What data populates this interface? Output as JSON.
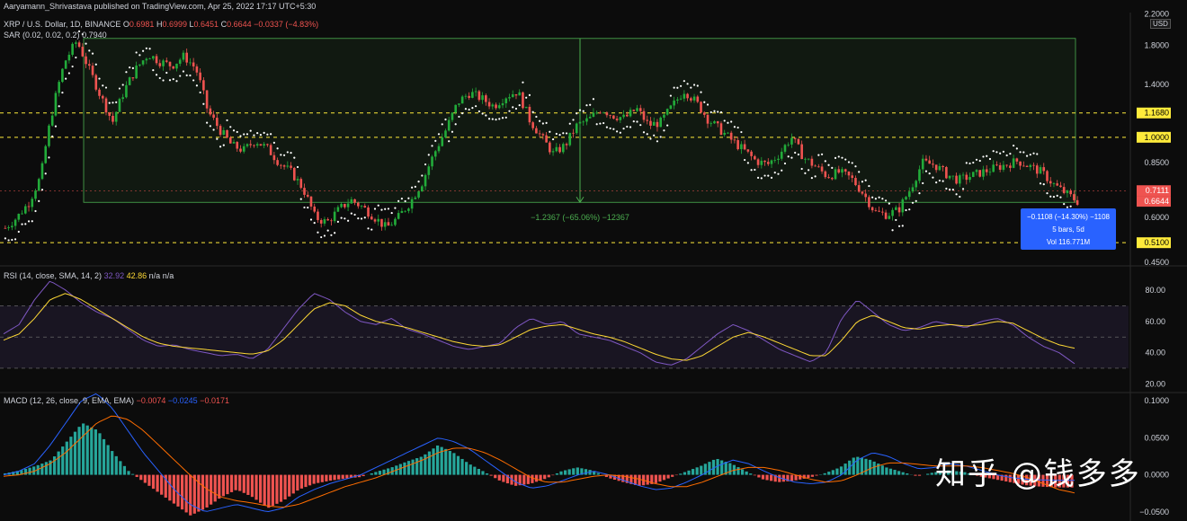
{
  "publisher_line": "Aaryamann_Shrivastava published on TradingView.com, Apr 25, 2022 17:17 UTC+5:30",
  "symbol_line": {
    "name": "XRP / U.S. Dollar, 1D, BINANCE",
    "o_label": "O",
    "o": "0.6981",
    "h_label": "H",
    "h": "0.6999",
    "l_label": "L",
    "l": "0.6451",
    "c_label": "C",
    "c": "0.6644",
    "change": "−0.0337 (−4.83%)"
  },
  "sar_line": {
    "label": "SAR (0.02, 0.02, 0.2)",
    "value": "0.7940"
  },
  "rsi_line": {
    "label": "RSI (14, close, SMA, 14, 2)",
    "rsi": "32.92",
    "sma": "42.86",
    "na1": "n/a",
    "na2": "n/a"
  },
  "macd_line": {
    "label": "MACD (12, 26, close, 9, EMA, EMA)",
    "macd": "−0.0074",
    "signal": "−0.0245",
    "hist": "−0.0171"
  },
  "currency_badge": "USD",
  "watermark": "知乎 @钱多多",
  "measure_text": "−1.2367 (−65.06%) −12367",
  "measure_box": {
    "line1": "−0.1108 (−14.30%) −1108",
    "line2": "5 bars, 5d",
    "line3": "Vol 116.771M"
  },
  "colors": {
    "up": "#26a69a",
    "up_bright": "#22ab3a",
    "down": "#ef5350",
    "level": "#ffeb3b",
    "sar": "#ffffff",
    "rsi": "#7e57c2",
    "rsi_ma": "#fdd835",
    "macd": "#2962ff",
    "signal": "#ff6d00",
    "measure": "#4caf50"
  },
  "chart_data": [
    {
      "type": "candlestick",
      "title": "XRP / U.S. Dollar, 1D, BINANCE",
      "scale": "log",
      "ylim": [
        0.45,
        2.0
      ],
      "y_ticks": [
        "2.2000",
        "1.8000",
        "1.4000",
        "1.1680",
        "1.0000",
        "0.8500",
        "0.7111",
        "0.6644",
        "0.6000",
        "0.5100",
        "0.4500"
      ],
      "tick_values": [
        2.2,
        1.8,
        1.4,
        1.168,
        1.0,
        0.85,
        0.7111,
        0.6644,
        0.6,
        0.51,
        0.45
      ],
      "horizontal_levels": [
        1.168,
        1.0,
        0.51
      ],
      "highlighted_prices": [
        {
          "label": "1.1680",
          "value": 1.168,
          "color": "#ffeb3b"
        },
        {
          "label": "1.0000",
          "value": 1.0,
          "color": "#ffeb3b"
        },
        {
          "label": "0.7111",
          "value": 0.7111,
          "color": "#ef5350"
        },
        {
          "label": "0.6644",
          "value": 0.6644,
          "color": "#ef5350"
        },
        {
          "label": "0.5100",
          "value": 0.51,
          "color": "#ffeb3b"
        }
      ],
      "close_path": [
        0.56,
        0.6,
        0.66,
        0.78,
        1.2,
        1.62,
        1.85,
        1.55,
        1.3,
        1.1,
        1.35,
        1.55,
        1.7,
        1.62,
        1.58,
        1.68,
        1.55,
        1.18,
        1.05,
        0.95,
        0.92,
        0.98,
        0.93,
        0.85,
        0.8,
        0.72,
        0.6,
        0.58,
        0.63,
        0.67,
        0.64,
        0.6,
        0.56,
        0.6,
        0.66,
        0.75,
        0.9,
        1.05,
        1.25,
        1.33,
        1.28,
        1.22,
        1.3,
        1.34,
        1.12,
        1.0,
        0.9,
        0.95,
        1.08,
        1.12,
        1.2,
        1.15,
        1.13,
        1.2,
        1.08,
        1.1,
        1.22,
        1.35,
        1.25,
        1.12,
        1.05,
        0.98,
        0.92,
        0.86,
        0.84,
        0.9,
        1.0,
        0.88,
        0.83,
        0.78,
        0.8,
        0.77,
        0.7,
        0.62,
        0.61,
        0.63,
        0.72,
        0.85,
        0.84,
        0.79,
        0.76,
        0.78,
        0.8,
        0.82,
        0.84,
        0.86,
        0.83,
        0.8,
        0.74,
        0.7,
        0.6644
      ]
    },
    {
      "type": "line",
      "title": "RSI (14, close, SMA, 14, 2)",
      "ylim": [
        15,
        95
      ],
      "y_ticks": [
        "80.00",
        "60.00",
        "40.00",
        "20.00"
      ],
      "tick_values": [
        80,
        60,
        40,
        20
      ],
      "bands": [
        70,
        50,
        30
      ],
      "series": [
        {
          "name": "RSI",
          "values": [
            52,
            58,
            74,
            86,
            80,
            72,
            66,
            62,
            55,
            48,
            44,
            45,
            42,
            40,
            38,
            39,
            36,
            42,
            55,
            68,
            78,
            74,
            66,
            60,
            58,
            62,
            55,
            52,
            48,
            44,
            42,
            44,
            46,
            56,
            62,
            58,
            60,
            52,
            50,
            48,
            44,
            40,
            34,
            32,
            36,
            44,
            52,
            58,
            54,
            48,
            42,
            38,
            34,
            40,
            62,
            74,
            66,
            58,
            54,
            56,
            60,
            58,
            56,
            60,
            62,
            58,
            50,
            44,
            40,
            32.92
          ]
        },
        {
          "name": "MA",
          "values": [
            48,
            52,
            62,
            74,
            78,
            74,
            68,
            62,
            56,
            50,
            46,
            44,
            43,
            42,
            41,
            40,
            39,
            41,
            48,
            58,
            68,
            72,
            70,
            64,
            60,
            58,
            56,
            53,
            50,
            47,
            45,
            44,
            45,
            50,
            55,
            57,
            58,
            55,
            52,
            50,
            47,
            43,
            39,
            36,
            35,
            38,
            44,
            50,
            53,
            50,
            46,
            42,
            38,
            38,
            48,
            60,
            64,
            60,
            56,
            55,
            57,
            58,
            57,
            58,
            60,
            59,
            54,
            49,
            45,
            42.86
          ]
        }
      ]
    },
    {
      "type": "bar",
      "title": "MACD (12, 26, close, 9, EMA, EMA)",
      "ylim": [
        -0.06,
        0.11
      ],
      "y_ticks": [
        "0.1000",
        "0.0500",
        "0.0000",
        "−0.0500"
      ],
      "tick_values": [
        0.1,
        0.05,
        0.0,
        -0.05
      ],
      "series": [
        {
          "name": "Histogram",
          "values": [
            0.002,
            0.006,
            0.012,
            0.02,
            0.045,
            0.07,
            0.06,
            0.03,
            0.005,
            -0.01,
            -0.025,
            -0.04,
            -0.055,
            -0.045,
            -0.03,
            -0.02,
            -0.03,
            -0.045,
            -0.035,
            -0.02,
            -0.012,
            -0.008,
            -0.005,
            -0.003,
            0.004,
            0.01,
            0.018,
            0.025,
            0.04,
            0.03,
            0.015,
            0.004,
            -0.008,
            -0.015,
            -0.012,
            -0.005,
            0.005,
            0.01,
            0.006,
            -0.004,
            -0.01,
            -0.015,
            -0.012,
            -0.004,
            0.004,
            0.012,
            0.022,
            0.015,
            0.004,
            -0.006,
            -0.01,
            -0.008,
            -0.004,
            0.002,
            0.01,
            0.025,
            0.02,
            0.01,
            0.004,
            -0.002,
            0.003,
            0.006,
            0.004,
            -0.002,
            -0.006,
            -0.01,
            -0.014,
            -0.016,
            -0.017,
            -0.0171
          ]
        },
        {
          "name": "MACD",
          "values": [
            0.0,
            0.005,
            0.015,
            0.04,
            0.07,
            0.1,
            0.11,
            0.09,
            0.06,
            0.03,
            0.005,
            -0.02,
            -0.04,
            -0.05,
            -0.045,
            -0.04,
            -0.045,
            -0.05,
            -0.045,
            -0.03,
            -0.02,
            -0.012,
            -0.006,
            0.0,
            0.01,
            0.02,
            0.03,
            0.04,
            0.05,
            0.045,
            0.035,
            0.02,
            0.005,
            -0.01,
            -0.018,
            -0.015,
            -0.008,
            0.0,
            0.005,
            0.0,
            -0.008,
            -0.015,
            -0.02,
            -0.018,
            -0.01,
            0.0,
            0.012,
            0.02,
            0.015,
            0.005,
            -0.004,
            -0.01,
            -0.012,
            -0.01,
            0.0,
            0.02,
            0.03,
            0.025,
            0.015,
            0.008,
            0.01,
            0.015,
            0.012,
            0.006,
            0.0,
            -0.004,
            -0.006,
            -0.007,
            -0.0074,
            -0.0074
          ]
        },
        {
          "name": "Signal",
          "values": [
            -0.002,
            0.0,
            0.005,
            0.015,
            0.03,
            0.05,
            0.07,
            0.08,
            0.075,
            0.06,
            0.04,
            0.02,
            0.0,
            -0.018,
            -0.03,
            -0.035,
            -0.038,
            -0.042,
            -0.044,
            -0.04,
            -0.032,
            -0.024,
            -0.016,
            -0.01,
            -0.004,
            0.004,
            0.012,
            0.02,
            0.03,
            0.036,
            0.036,
            0.03,
            0.02,
            0.008,
            -0.004,
            -0.01,
            -0.01,
            -0.006,
            -0.002,
            0.0,
            -0.002,
            -0.006,
            -0.012,
            -0.016,
            -0.016,
            -0.01,
            -0.002,
            0.006,
            0.01,
            0.01,
            0.006,
            0.0,
            -0.006,
            -0.01,
            -0.008,
            0.0,
            0.01,
            0.016,
            0.016,
            0.014,
            0.012,
            0.012,
            0.012,
            0.01,
            0.006,
            0.002,
            -0.004,
            -0.012,
            -0.02,
            -0.0245
          ]
        }
      ]
    }
  ]
}
